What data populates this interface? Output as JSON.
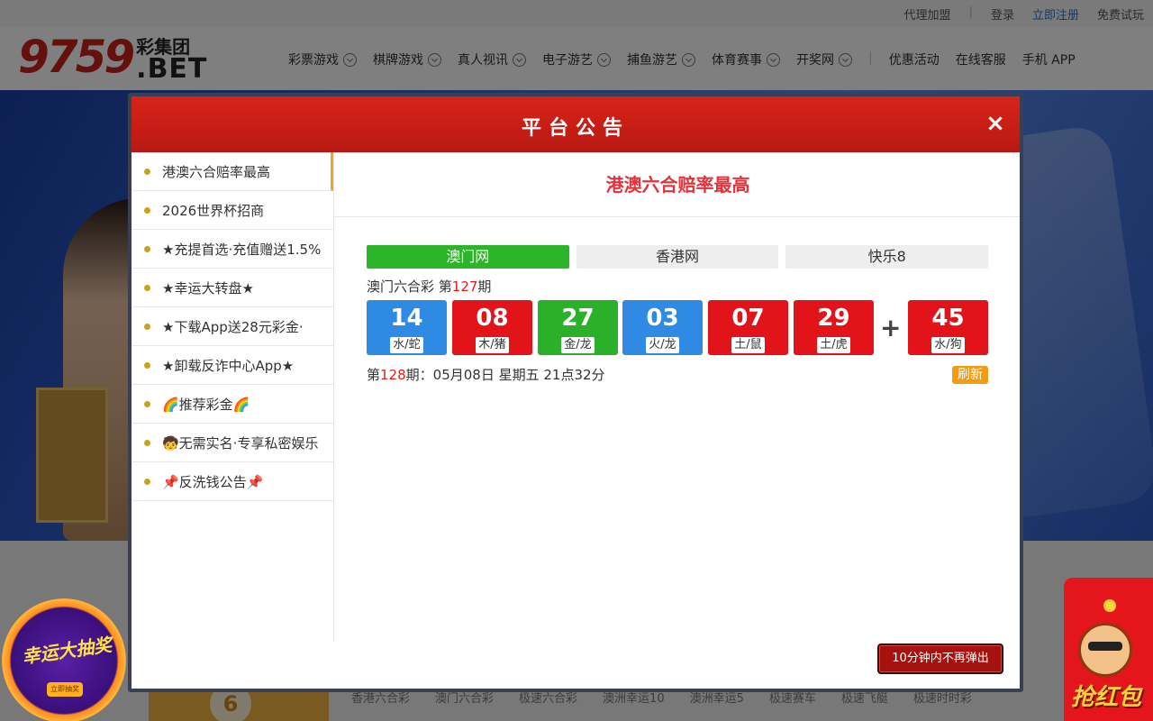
{
  "topbar": {
    "links": [
      "代理加盟",
      "登录",
      "立即注册",
      "免费试玩"
    ]
  },
  "header": {
    "logo_number": "9759",
    "logo_cn": "彩集团",
    "logo_bet": ".BET",
    "nav": [
      {
        "label": "彩票游戏",
        "dropdown": true
      },
      {
        "label": "棋牌游戏",
        "dropdown": true
      },
      {
        "label": "真人视讯",
        "dropdown": true
      },
      {
        "label": "电子游艺",
        "dropdown": true
      },
      {
        "label": "捕鱼游艺",
        "dropdown": true
      },
      {
        "label": "体育赛事",
        "dropdown": true
      },
      {
        "label": "开奖网",
        "dropdown": true
      },
      {
        "label": "优惠活动",
        "dropdown": false
      },
      {
        "label": "在线客服",
        "dropdown": false
      },
      {
        "label": "手机 APP",
        "dropdown": false
      }
    ]
  },
  "background": {
    "lottery_tabs": [
      "香港六合彩",
      "澳门六合彩",
      "极速六合彩",
      "澳洲幸运10",
      "澳洲幸运5",
      "极速赛车",
      "极速飞艇",
      "极速时时彩"
    ],
    "card_number": "6",
    "lucky_text": "幸运大抽奖",
    "lucky_button": "立即抽奖",
    "redpack_text": "抢红包"
  },
  "modal": {
    "title": "平台公告",
    "close": "×",
    "sidebar": [
      "港澳六合赔率最高",
      "2026世界杯招商",
      "★充提首选·充值赠送1.5%",
      "★幸运大转盘★",
      "★下载App送28元彩金·",
      "★卸载反诈中心App★",
      "🌈推荐彩金🌈",
      "🧒无需实名·专享私密娱乐",
      "📌反洗钱公告📌"
    ],
    "active_index": 0,
    "content_title": "港澳六合赔率最高",
    "lottery_tabs": [
      "澳门网",
      "香港网",
      "快乐8"
    ],
    "active_tab": 0,
    "period_prefix": "澳门六合彩 第",
    "period_number": "127",
    "period_suffix": "期",
    "balls": [
      {
        "num": "14",
        "zodiac": "水/蛇",
        "color": "blue"
      },
      {
        "num": "08",
        "zodiac": "木/猪",
        "color": "red"
      },
      {
        "num": "27",
        "zodiac": "金/龙",
        "color": "green"
      },
      {
        "num": "03",
        "zodiac": "火/龙",
        "color": "blue"
      },
      {
        "num": "07",
        "zodiac": "土/鼠",
        "color": "red"
      },
      {
        "num": "29",
        "zodiac": "土/虎",
        "color": "red"
      }
    ],
    "plus": "+",
    "special_ball": {
      "num": "45",
      "zodiac": "水/狗",
      "color": "red"
    },
    "next_prefix": "第",
    "next_number": "128",
    "next_suffix": "期：05月08日 星期五 21点32分",
    "refresh": "刷新",
    "mute_button": "10分钟内不再弹出"
  }
}
